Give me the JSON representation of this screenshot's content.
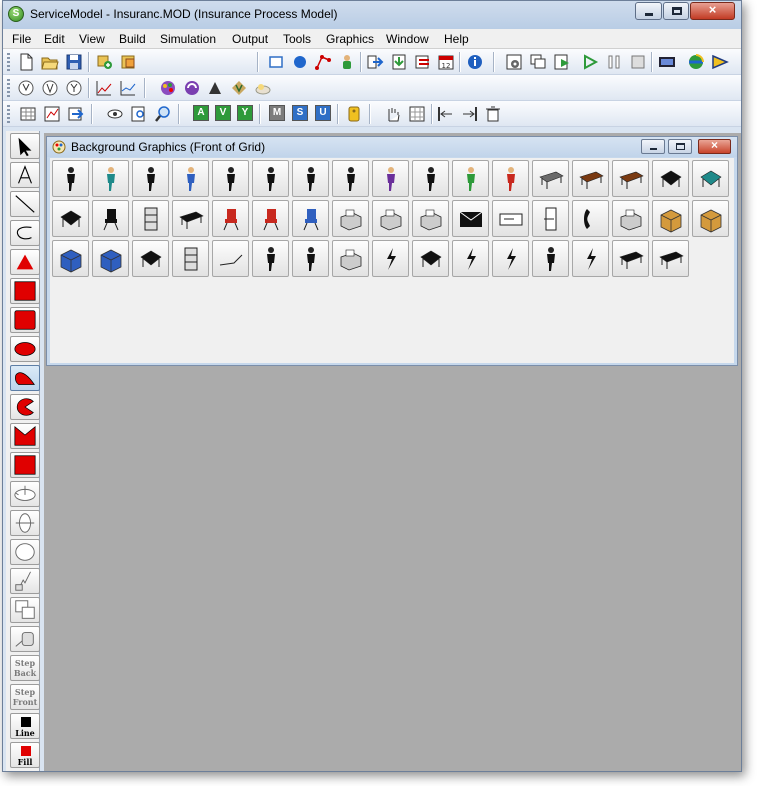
{
  "window": {
    "title": "ServiceModel - Insuranc.MOD (Insurance Process Model)",
    "app_icon_letter": "S",
    "close_glyph": "×"
  },
  "menubar": {
    "items": [
      "File",
      "Edit",
      "View",
      "Build",
      "Simulation",
      "Output",
      "Tools",
      "Graphics",
      "Window",
      "Help"
    ]
  },
  "toolbar3_letters": [
    "A",
    "V",
    "Y",
    "M",
    "S",
    "U"
  ],
  "toolbar3_letter_colors": [
    "#2e9a3a",
    "#2e9a3a",
    "#2e9a3a",
    "#7c7c7c",
    "#2f6fc6",
    "#2f6fc6"
  ],
  "palette": {
    "step_back_label": [
      "Step",
      "Back"
    ],
    "step_front_label": [
      "Step",
      "Front"
    ],
    "line_label": "Line",
    "fill_label": "Fill"
  },
  "child_window": {
    "title": "Background Graphics (Front of Grid)",
    "close_glyph": "×"
  },
  "graphic_icons": [
    "person-standing-icon",
    "person-teal-icon",
    "person-black-icon",
    "person-blue-pink-icon",
    "person-suit-icon",
    "person-walking-icon",
    "person-bag-icon",
    "person-running-icon",
    "person-sitting-purple-icon",
    "person-outline-icon",
    "person-green-icon",
    "person-red-icon",
    "desk-gray-icon",
    "desk-brown-icon",
    "table-brown-icon",
    "cubicle-icon",
    "workstation-teal-icon",
    "workstation-left-icon",
    "chair-black-icon",
    "file-cabinet-icon",
    "table-round-icon",
    "chair-red-icon",
    "chair-red-2-icon",
    "chair-blue-icon",
    "typewriter-icon",
    "fax-icon",
    "printer-icon",
    "envelope-icon",
    "check-icon",
    "paper-icon",
    "telephone-icon",
    "machine-icon",
    "box-closed-icon",
    "box-open-icon",
    "bin-blue-icon",
    "cart-blue-icon",
    "pallet-icon",
    "rack-icon",
    "line-sketch-icon",
    "person-at-desk-icon",
    "person-at-counter-icon",
    "monitor-icon",
    "lightning-icon",
    "forklift-icon",
    "lightning-2-icon",
    "lightning-3-icon",
    "person-sitting-icon",
    "lightning-4-icon",
    "platform-icon",
    "bench-icon"
  ],
  "colors": {
    "title_bar": "#c3d5ea",
    "workspace": "#ababab",
    "palette_red": "#e00000",
    "close_red": "#c8442c"
  }
}
